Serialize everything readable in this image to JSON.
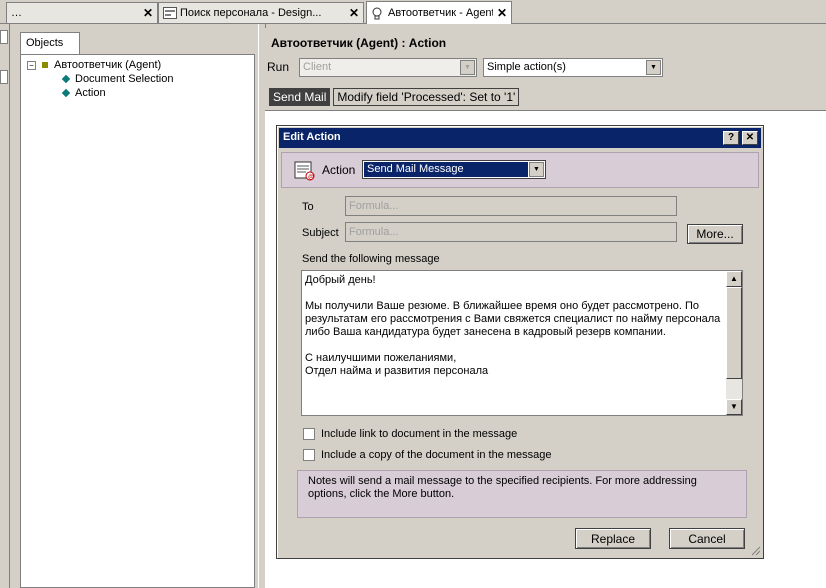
{
  "tabs": [
    {
      "label": "…",
      "active": false
    },
    {
      "label": "Поиск персонала          - Design...",
      "active": false
    },
    {
      "label": "Автоответчик - Agent",
      "active": true
    }
  ],
  "tab_close": "✕",
  "left": {
    "tab_label": "Objects",
    "tree": [
      {
        "label": "Автоответчик (Agent)",
        "level": 0
      },
      {
        "label": "Document Selection",
        "level": 1
      },
      {
        "label": "Action",
        "level": 1
      }
    ]
  },
  "right": {
    "title": "Автоответчик (Agent) : Action",
    "run_label": "Run",
    "run_value": "Client",
    "mode_value": "Simple action(s)",
    "actions": [
      "Send Mail",
      "Modify field 'Processed': Set to '1'"
    ]
  },
  "dialog": {
    "title": "Edit Action",
    "help": "?",
    "close": "✕",
    "action_label": "Action",
    "action_value": "Send Mail Message",
    "to_label": "To",
    "to_placeholder": "Formula...",
    "subject_label": "Subject",
    "subject_placeholder": "Formula...",
    "more_button": "More...",
    "message_label": "Send the following message",
    "message": "Добрый день!\n\nМы получили Ваше резюме. В ближайшее время оно будет рассмотрено. По результатам его рассмотрения с Вами свяжется специалист по найму персонала либо Ваша кандидатура будет занесена в кадровый резерв компании.\n\nС наилучшими пожеланиями,\nОтдел найма и развития персонала",
    "include_link": "Include link to document in the message",
    "include_copy": "Include a copy of the document in the message",
    "note": "Notes will send a mail message to the specified recipients.  For more addressing options, click the More button.",
    "replace_button": "Replace",
    "cancel_button": "Cancel"
  }
}
